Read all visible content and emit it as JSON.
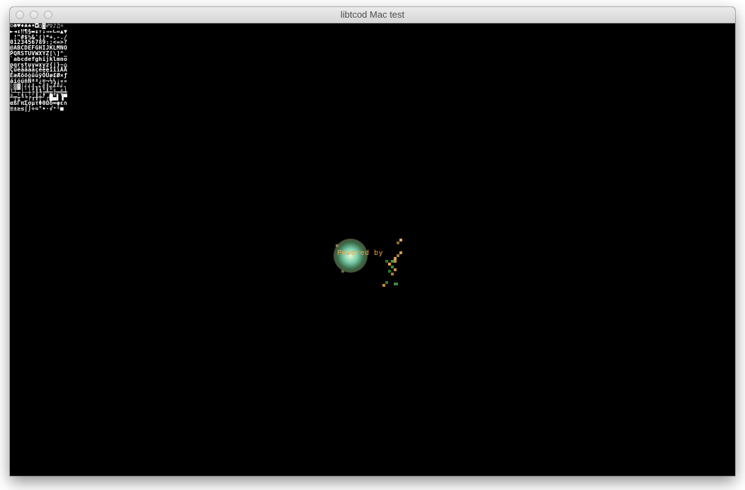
{
  "window": {
    "title": "libtcod Mac test"
  },
  "console": {
    "charset_lines": [
      "☺☻♥♦♣♠•◘○◙♂♀♪♫☼",
      "►◄↕‼¶§▬↨↑↓→←∟↔▲▼",
      " !\"#$%&'()*+,-./",
      "0123456789:;<=>?",
      "@ABCDEFGHIJKLMNO",
      "PQRSTUVWXYZ[\\]^_",
      "`abcdefghijklmno",
      "pqrstuvwxyz{|}~⌂",
      "ÇüéâäàåçêëèïîìÄÅ",
      "ÉæÆôöòûùÿÖÜø£Ø×ƒ",
      "áíóúñÑªº¿®¬½¼¡«»",
      "░▒▓│┤╡╢╖╕╣║╗╝╜╛┐",
      "└┴┬├─┼╞╟╚╔╩╦╠═╬╧",
      "╨╤╥╙╘╒╓╫╪┘┌█▄▌▐▀",
      "αßΓπΣσµτΦΘΩδ∞φε∩",
      "≡±≥≤⌠⌡÷≈°∙·√ⁿ²■ "
    ],
    "logo_text": "Powered by"
  },
  "colors": {
    "background": "#000000",
    "charset": "#ffffff",
    "logo_text": "#f0a040"
  }
}
